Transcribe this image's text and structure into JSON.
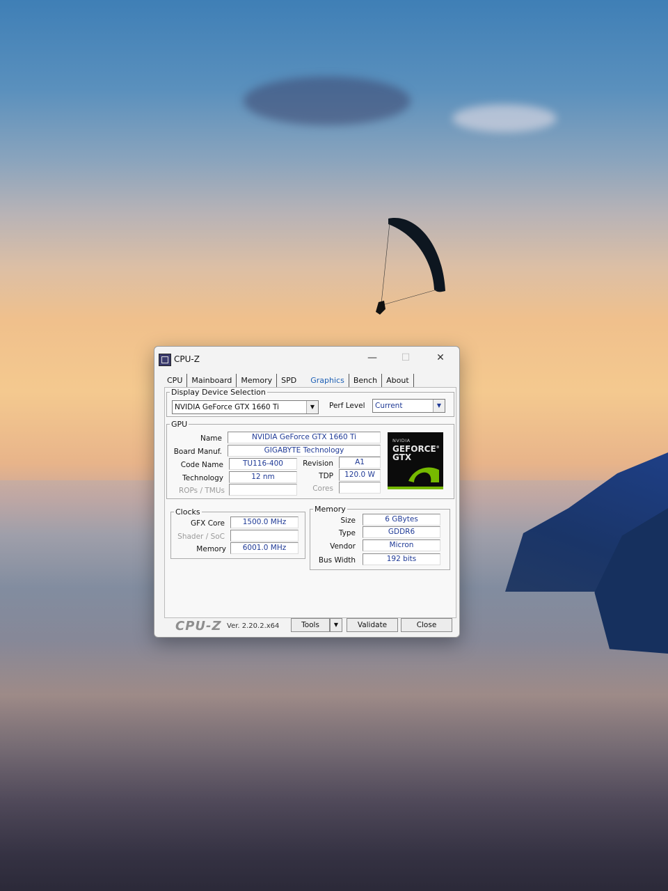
{
  "window": {
    "title": "CPU-Z",
    "minimize": "—",
    "maximize": "☐",
    "close": "✕"
  },
  "tabs": [
    "CPU",
    "Mainboard",
    "Memory",
    "SPD",
    "Graphics",
    "Bench",
    "About"
  ],
  "active_tab": "Graphics",
  "display_selection": {
    "legend": "Display Device Selection",
    "device": "NVIDIA GeForce GTX 1660 Ti",
    "perf_label": "Perf Level",
    "perf_value": "Current"
  },
  "gpu": {
    "legend": "GPU",
    "name_label": "Name",
    "name": "NVIDIA GeForce GTX 1660 Ti",
    "board_label": "Board Manuf.",
    "board": "GIGABYTE Technology",
    "code_label": "Code Name",
    "code": "TU116-400",
    "revision_label": "Revision",
    "revision": "A1",
    "tech_label": "Technology",
    "tech": "12 nm",
    "tdp_label": "TDP",
    "tdp": "120.0 W",
    "rops_label": "ROPs / TMUs",
    "rops": "",
    "cores_label": "Cores",
    "cores": ""
  },
  "logo": {
    "small": "NVIDIA",
    "line1": "GEFORCE",
    "line2": "GTX",
    "tm": "®"
  },
  "clocks": {
    "legend": "Clocks",
    "gfx_label": "GFX Core",
    "gfx": "1500.0 MHz",
    "shader_label": "Shader / SoC",
    "shader": "",
    "mem_label": "Memory",
    "mem": "6001.0 MHz"
  },
  "memory": {
    "legend": "Memory",
    "size_label": "Size",
    "size": "6 GBytes",
    "type_label": "Type",
    "type": "GDDR6",
    "vendor_label": "Vendor",
    "vendor": "Micron",
    "bus_label": "Bus Width",
    "bus": "192 bits"
  },
  "bottom": {
    "brand": "CPU-Z",
    "version": "Ver. 2.20.2.x64",
    "tools": "Tools",
    "validate": "Validate",
    "close": "Close"
  }
}
